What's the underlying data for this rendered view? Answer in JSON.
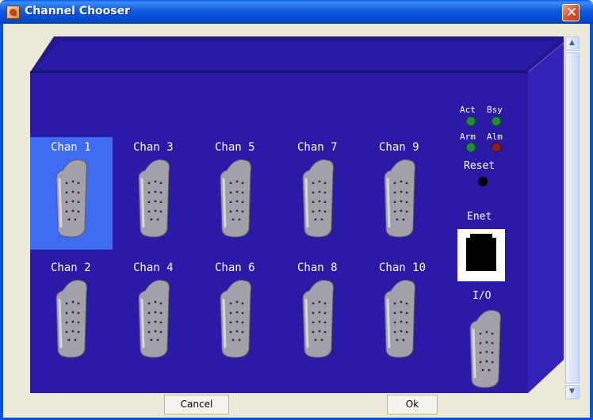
{
  "window": {
    "title": "Channel Chooser",
    "close_label": "✕"
  },
  "panel": {
    "channels": [
      {
        "label": "Chan 1",
        "selected": true
      },
      {
        "label": "Chan 3",
        "selected": false
      },
      {
        "label": "Chan 5",
        "selected": false
      },
      {
        "label": "Chan 7",
        "selected": false
      },
      {
        "label": "Chan 9",
        "selected": false
      },
      {
        "label": "Chan 2",
        "selected": false
      },
      {
        "label": "Chan 4",
        "selected": false
      },
      {
        "label": "Chan 6",
        "selected": false
      },
      {
        "label": "Chan 8",
        "selected": false
      },
      {
        "label": "Chan 10",
        "selected": false
      }
    ],
    "leds": {
      "act": "Act",
      "bsy": "Bsy",
      "arm": "Arm",
      "alm": "Alm"
    },
    "reset_label": "Reset",
    "enet_label": "Enet",
    "io_label": "I/O",
    "colors": {
      "panel": "#2b1aa6",
      "selected": "#3f6cf2",
      "led_green": "#1f8a3a",
      "led_red": "#8a1d23"
    }
  },
  "buttons": {
    "cancel": "Cancel",
    "ok": "Ok"
  }
}
